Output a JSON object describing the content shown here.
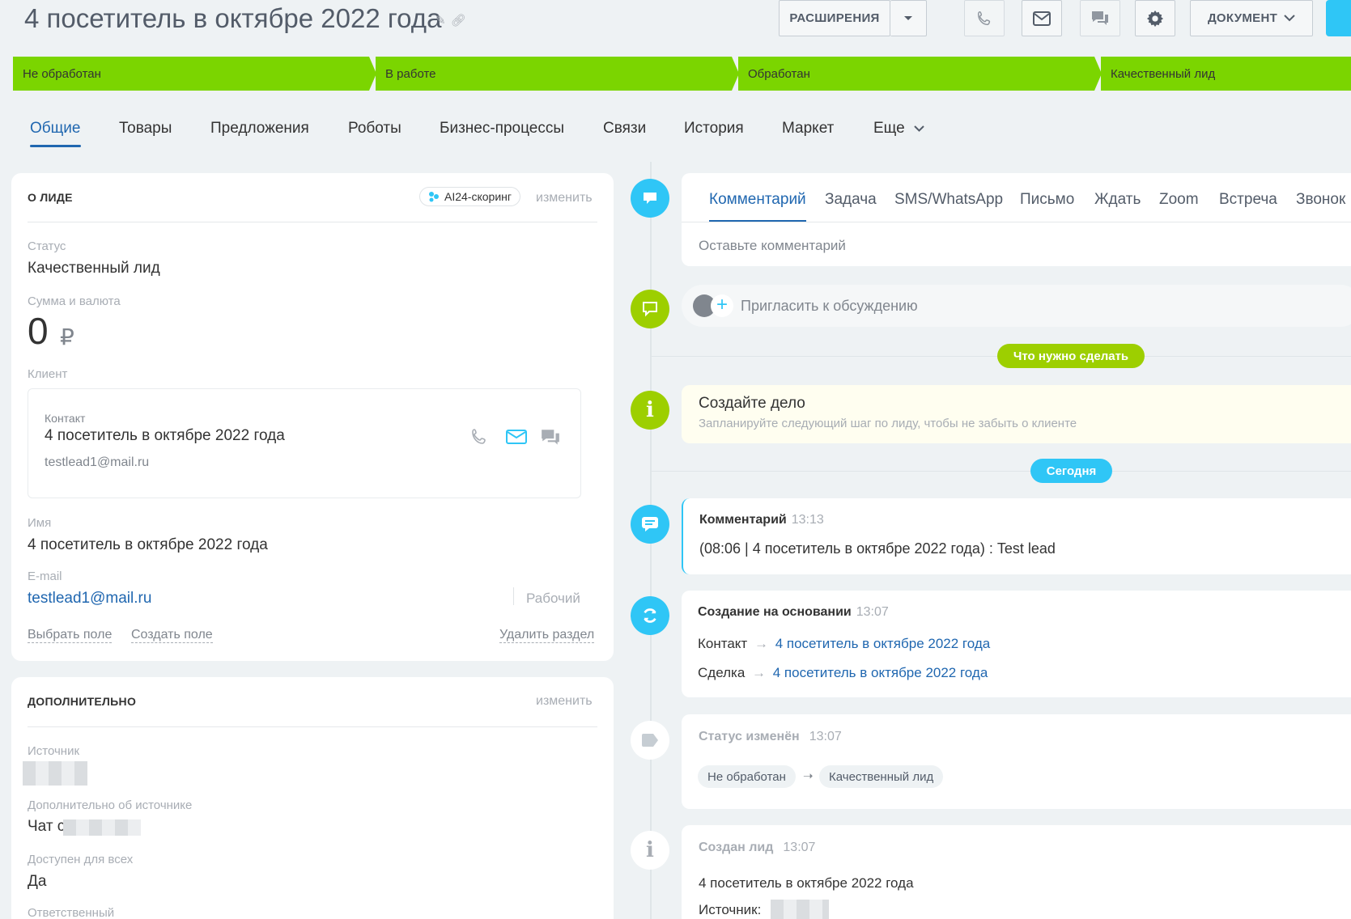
{
  "header": {
    "title": "4 посетитель в октябре 2022 года",
    "extensions_label": "РАСШИРЕНИЯ",
    "document_label": "ДОКУМЕНТ"
  },
  "stages": [
    {
      "label": "Не обработан"
    },
    {
      "label": "В работе"
    },
    {
      "label": "Обработан"
    },
    {
      "label": "Качественный лид"
    }
  ],
  "tabs": [
    {
      "label": "Общие"
    },
    {
      "label": "Товары"
    },
    {
      "label": "Предложения"
    },
    {
      "label": "Роботы"
    },
    {
      "label": "Бизнес-процессы"
    },
    {
      "label": "Связи"
    },
    {
      "label": "История"
    },
    {
      "label": "Маркет"
    },
    {
      "label": "Еще"
    }
  ],
  "about": {
    "title": "О ЛИДЕ",
    "ai_label": "AI24-скоринг",
    "edit_label": "изменить",
    "status_label": "Статус",
    "status_value": "Качественный лид",
    "sum_label": "Сумма и валюта",
    "sum_value": "0",
    "currency": "₽",
    "client_label": "Клиент",
    "contact_label": "Контакт",
    "contact_name": "4 посетитель в октябре 2022 года",
    "contact_email": "testlead1@mail.ru",
    "name_label": "Имя",
    "name_value": "4 посетитель в октябре 2022 года",
    "email_label": "E-mail",
    "email_value": "testlead1@mail.ru",
    "email_type": "Рабочий",
    "choose_field": "Выбрать поле",
    "create_field": "Создать поле",
    "delete_section": "Удалить раздел"
  },
  "extra": {
    "title": "ДОПОЛНИТЕЛЬНО",
    "edit_label": "изменить",
    "source_label": "Источник",
    "source_more_label": "Дополнительно об источнике",
    "source_more_value": "Чат с",
    "available_label": "Доступен для всех",
    "available_value": "Да",
    "responsible_label": "Ответственный"
  },
  "composer": {
    "tabs": [
      {
        "label": "Комментарий"
      },
      {
        "label": "Задача"
      },
      {
        "label": "SMS/WhatsApp"
      },
      {
        "label": "Письмо"
      },
      {
        "label": "Ждать"
      },
      {
        "label": "Zoom"
      },
      {
        "label": "Встреча"
      },
      {
        "label": "Звонок"
      }
    ],
    "placeholder": "Оставьте комментарий"
  },
  "timeline": {
    "invite_label": "Пригласить к обсуждению",
    "todo_pill": "Что нужно сделать",
    "create_task_title": "Создайте дело",
    "create_task_hint": "Запланируйте следующий шаг по лиду, чтобы не забыть о клиенте",
    "today_pill": "Сегодня",
    "comment": {
      "title": "Комментарий",
      "time": "13:13",
      "text": "(08:06 | 4 посетитель в октябре 2022 года) : Test lead"
    },
    "created_from": {
      "title": "Создание на основании",
      "time": "13:07",
      "contact_label": "Контакт",
      "contact_link": "4 посетитель в октябре 2022 года",
      "deal_label": "Сделка",
      "deal_link": "4 посетитель в октябре 2022 года"
    },
    "status_changed": {
      "title": "Статус изменён",
      "time": "13:07",
      "from": "Не обработан",
      "to": "Качественный лид"
    },
    "lead_created": {
      "title": "Создан лид",
      "time": "13:07",
      "name": "4 посетитель в октябре 2022 года",
      "source_label": "Источник:"
    }
  },
  "colors": {
    "stage_green": "#7bd500",
    "accent_blue": "#2fc6f6",
    "link_blue": "#2067b0",
    "timeline_green": "#9dcf00"
  }
}
